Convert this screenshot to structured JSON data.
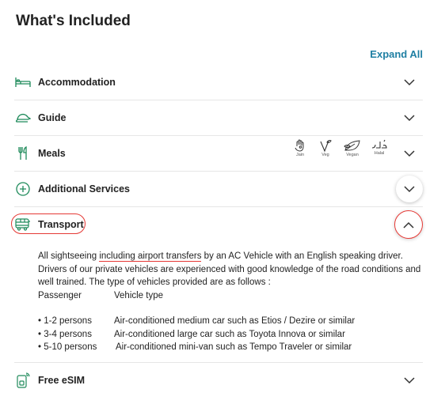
{
  "title": "What's Included",
  "expand_all": "Expand All",
  "sections": [
    {
      "label": "Accommodation"
    },
    {
      "label": "Guide"
    },
    {
      "label": "Meals"
    },
    {
      "label": "Additional Services"
    },
    {
      "label": "Transport"
    },
    {
      "label": "Free eSIM"
    }
  ],
  "diet_icons": [
    "Jain",
    "Veg",
    "Vegan",
    "Halal"
  ],
  "transport": {
    "para_before": "All sightseeing ",
    "para_underlined": "including airport transfers",
    "para_after": " by an AC Vehicle with an English speaking driver. Drivers of our private vehicles are experienced with good knowledge of the road conditions and well trained. The type of vehicles provided are as follows :",
    "header_col1": "Passenger",
    "header_col2": "Vehicle type",
    "rows": [
      {
        "p": "• 1-2 persons",
        "v": "Air-conditioned medium car such as Etios / Dezire or similar"
      },
      {
        "p": "• 3-4 persons",
        "v": "Air-conditioned large car such as Toyota Innova or similar"
      },
      {
        "p": "• 5-10 persons",
        "v": "Air-conditioned mini-van such as Tempo Traveler or similar"
      }
    ]
  },
  "colors": {
    "accent": "#1e8a5a",
    "link": "#1f7fa3",
    "highlight": "#e53935"
  }
}
